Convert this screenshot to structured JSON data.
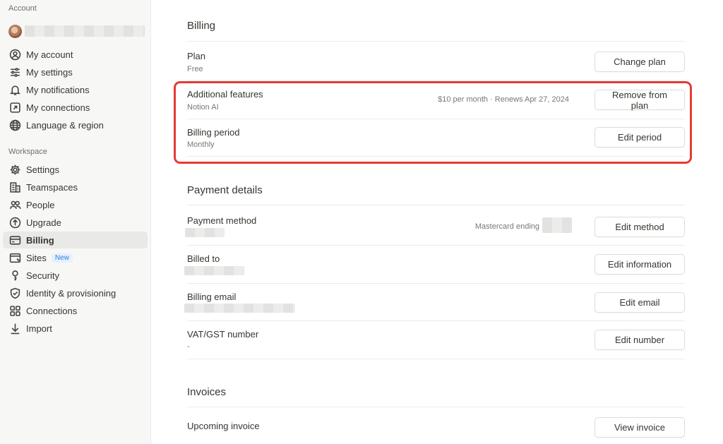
{
  "sidebar": {
    "account_label": "Account",
    "account_items": [
      {
        "label": "My account",
        "icon": "person-circle-icon"
      },
      {
        "label": "My settings",
        "icon": "sliders-icon"
      },
      {
        "label": "My notifications",
        "icon": "bell-icon"
      },
      {
        "label": "My connections",
        "icon": "external-arrow-icon"
      },
      {
        "label": "Language & region",
        "icon": "globe-icon"
      }
    ],
    "workspace_label": "Workspace",
    "workspace_items": [
      {
        "label": "Settings",
        "icon": "gear-icon"
      },
      {
        "label": "Teamspaces",
        "icon": "building-icon"
      },
      {
        "label": "People",
        "icon": "people-icon"
      },
      {
        "label": "Upgrade",
        "icon": "arrow-up-circle-icon"
      },
      {
        "label": "Billing",
        "icon": "credit-card-icon",
        "active": true
      },
      {
        "label": "Sites",
        "icon": "browser-window-icon",
        "badge": "New"
      },
      {
        "label": "Security",
        "icon": "key-icon"
      },
      {
        "label": "Identity & provisioning",
        "icon": "shield-check-icon"
      },
      {
        "label": "Connections",
        "icon": "grid-icon"
      },
      {
        "label": "Import",
        "icon": "download-arrow-icon"
      }
    ]
  },
  "billing": {
    "heading": "Billing",
    "plan": {
      "title": "Plan",
      "value": "Free",
      "button": "Change plan"
    },
    "features": {
      "title": "Additional features",
      "value": "Notion AI",
      "meta": "$10 per month · Renews Apr 27, 2024",
      "button": "Remove from plan"
    },
    "period": {
      "title": "Billing period",
      "value": "Monthly",
      "button": "Edit period"
    }
  },
  "payment": {
    "heading": "Payment details",
    "method": {
      "title": "Payment method",
      "meta": "Mastercard ending",
      "button": "Edit method"
    },
    "billed_to": {
      "title": "Billed to",
      "button": "Edit information"
    },
    "email": {
      "title": "Billing email",
      "button": "Edit email"
    },
    "vat": {
      "title": "VAT/GST number",
      "value": "-",
      "button": "Edit number"
    }
  },
  "invoices": {
    "heading": "Invoices",
    "upcoming": {
      "title": "Upcoming invoice",
      "button": "View invoice"
    }
  },
  "colors": {
    "highlight": "#e53b35",
    "sidebar_bg": "#f7f7f5",
    "badge": "#2383e2"
  }
}
